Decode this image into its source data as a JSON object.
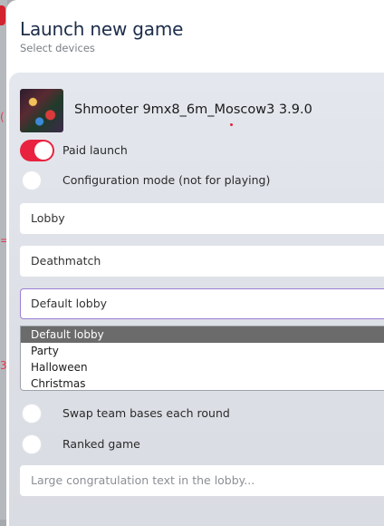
{
  "modal": {
    "title": "Launch new game",
    "subtitle": "Select devices"
  },
  "game": {
    "name": "Shmooter 9mx8_6m_Moscow3 3.9.0",
    "thumbnail_icon": "game-cover-art"
  },
  "options": {
    "paid_launch": {
      "label": "Paid launch",
      "on": true
    },
    "config_mode": {
      "label": "Configuration mode (not for playing)",
      "on": false
    },
    "swap_bases": {
      "label": "Swap team bases each round",
      "on": false
    },
    "ranked": {
      "label": "Ranked game",
      "on": false
    }
  },
  "fields": {
    "mode": "Lobby",
    "game_type": "Deathmatch",
    "lobby_select": "Default lobby",
    "congrats_placeholder": "Large congratulation text in the lobby..."
  },
  "lobby_options": [
    "Default lobby",
    "Party",
    "Halloween",
    "Christmas"
  ],
  "colors": {
    "accent": "#e8223f",
    "focus": "#9b7fd6",
    "selected_option": "#6b6b6b"
  }
}
